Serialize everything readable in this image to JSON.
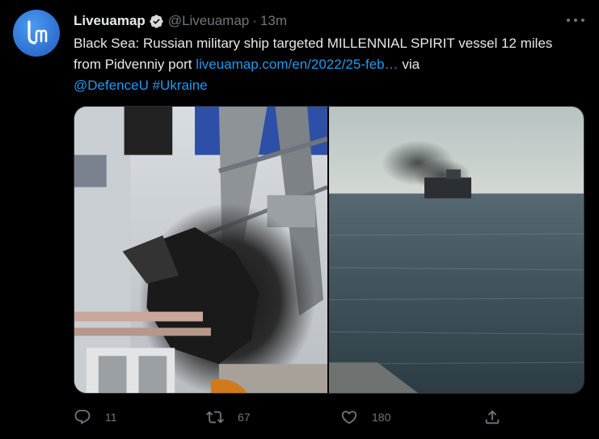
{
  "author": {
    "display_name": "Liveuamap",
    "handle": "@Liveuamap",
    "separator": "·",
    "time": "13m",
    "verified": true,
    "avatar_icon": "liveuamap-logo-icon",
    "avatar_color": "#2d6fd0"
  },
  "tweet": {
    "text_main": "Black Sea: Russian military ship targeted MILLENNIAL SPIRIT vessel 12 miles from Pidvenniy port ",
    "link_text": "liveuamap.com/en/2022/25-feb…",
    "text_via": " via ",
    "mention": "@DefenceU",
    "hashtag": "#Ukraine"
  },
  "media": {
    "photo_left_icon": "damaged-ship-hull-photo",
    "photo_right_icon": "burning-ship-at-sea-photo"
  },
  "actions": {
    "reply_count": "11",
    "retweet_count": "67",
    "like_count": "180",
    "reply_icon": "reply-icon",
    "retweet_icon": "retweet-icon",
    "like_icon": "heart-icon",
    "share_icon": "share-icon"
  },
  "colors": {
    "background": "#000000",
    "text": "#e7e9ea",
    "muted": "#71767b",
    "link": "#1d9bf0",
    "verified_badge": "#d9d9d9"
  }
}
